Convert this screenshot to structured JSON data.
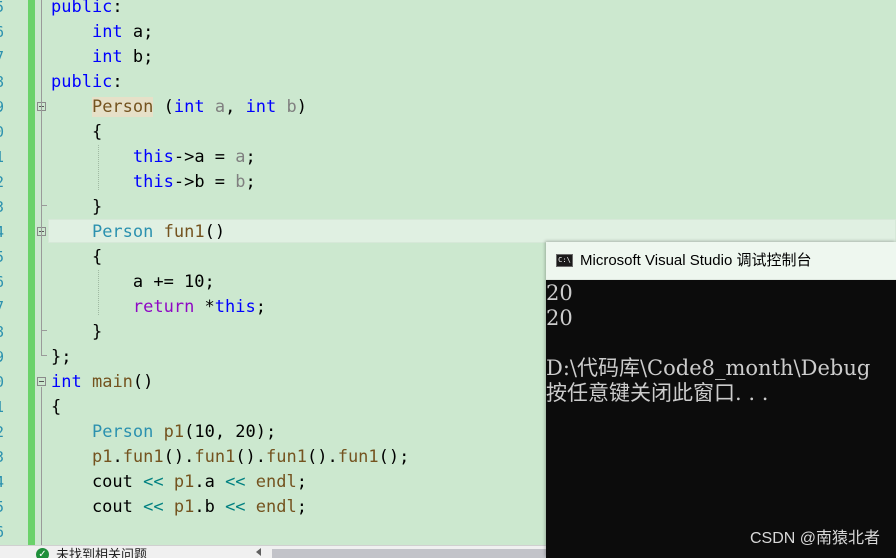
{
  "editor": {
    "line_numbers": [
      "5",
      "6",
      "7",
      "8",
      "9",
      "0",
      "1",
      "2",
      "3",
      "4",
      "5",
      "6",
      "7",
      "8",
      "9",
      "0",
      "1",
      "2",
      "3",
      "4",
      "5",
      "6"
    ],
    "lines": [
      {
        "segments": [
          {
            "t": "public",
            "c": "kw"
          },
          {
            "t": ":",
            "c": ""
          }
        ]
      },
      {
        "segments": [
          {
            "t": "    ",
            "c": ""
          },
          {
            "t": "int",
            "c": "kw"
          },
          {
            "t": " a;",
            "c": ""
          }
        ]
      },
      {
        "segments": [
          {
            "t": "    ",
            "c": ""
          },
          {
            "t": "int",
            "c": "kw"
          },
          {
            "t": " b;",
            "c": ""
          }
        ]
      },
      {
        "segments": [
          {
            "t": "public",
            "c": "kw"
          },
          {
            "t": ":",
            "c": ""
          }
        ]
      },
      {
        "segments": [
          {
            "t": "    ",
            "c": ""
          },
          {
            "t": "Person",
            "c": "fn hl"
          },
          {
            "t": " (",
            "c": ""
          },
          {
            "t": "int",
            "c": "kw"
          },
          {
            "t": " ",
            "c": ""
          },
          {
            "t": "a",
            "c": "pm"
          },
          {
            "t": ", ",
            "c": ""
          },
          {
            "t": "int",
            "c": "kw"
          },
          {
            "t": " ",
            "c": ""
          },
          {
            "t": "b",
            "c": "pm"
          },
          {
            "t": ")",
            "c": ""
          }
        ]
      },
      {
        "segments": [
          {
            "t": "    {",
            "c": ""
          }
        ]
      },
      {
        "segments": [
          {
            "t": "        ",
            "c": ""
          },
          {
            "t": "this",
            "c": "kw"
          },
          {
            "t": "->a = ",
            "c": ""
          },
          {
            "t": "a",
            "c": "pm"
          },
          {
            "t": ";",
            "c": ""
          }
        ]
      },
      {
        "segments": [
          {
            "t": "        ",
            "c": ""
          },
          {
            "t": "this",
            "c": "kw"
          },
          {
            "t": "->b = ",
            "c": ""
          },
          {
            "t": "b",
            "c": "pm"
          },
          {
            "t": ";",
            "c": ""
          }
        ]
      },
      {
        "segments": [
          {
            "t": "    }",
            "c": ""
          }
        ]
      },
      {
        "segments": [
          {
            "t": "    ",
            "c": ""
          },
          {
            "t": "Person",
            "c": "ty"
          },
          {
            "t": " ",
            "c": ""
          },
          {
            "t": "fun1",
            "c": "fn"
          },
          {
            "t": "()",
            "c": ""
          }
        ]
      },
      {
        "segments": [
          {
            "t": "    {",
            "c": ""
          }
        ]
      },
      {
        "segments": [
          {
            "t": "        a += 10;",
            "c": ""
          }
        ]
      },
      {
        "segments": [
          {
            "t": "        ",
            "c": ""
          },
          {
            "t": "return",
            "c": "ctl"
          },
          {
            "t": " *",
            "c": ""
          },
          {
            "t": "this",
            "c": "kw"
          },
          {
            "t": ";",
            "c": ""
          }
        ]
      },
      {
        "segments": [
          {
            "t": "    }",
            "c": ""
          }
        ]
      },
      {
        "segments": [
          {
            "t": "};",
            "c": ""
          }
        ]
      },
      {
        "segments": [
          {
            "t": "int",
            "c": "kw"
          },
          {
            "t": " ",
            "c": ""
          },
          {
            "t": "main",
            "c": "fn"
          },
          {
            "t": "()",
            "c": ""
          }
        ]
      },
      {
        "segments": [
          {
            "t": "{",
            "c": ""
          }
        ]
      },
      {
        "segments": [
          {
            "t": "    ",
            "c": ""
          },
          {
            "t": "Person",
            "c": "ty"
          },
          {
            "t": " ",
            "c": ""
          },
          {
            "t": "p1",
            "c": "fn"
          },
          {
            "t": "(10, 20);",
            "c": ""
          }
        ]
      },
      {
        "segments": [
          {
            "t": "    ",
            "c": ""
          },
          {
            "t": "p1",
            "c": "fn"
          },
          {
            "t": ".",
            "c": ""
          },
          {
            "t": "fun1",
            "c": "fn"
          },
          {
            "t": "().",
            "c": ""
          },
          {
            "t": "fun1",
            "c": "fn"
          },
          {
            "t": "().",
            "c": ""
          },
          {
            "t": "fun1",
            "c": "fn"
          },
          {
            "t": "().",
            "c": ""
          },
          {
            "t": "fun1",
            "c": "fn"
          },
          {
            "t": "();",
            "c": ""
          }
        ]
      },
      {
        "segments": [
          {
            "t": "    cout ",
            "c": ""
          },
          {
            "t": "<<",
            "c": "op"
          },
          {
            "t": " ",
            "c": ""
          },
          {
            "t": "p1",
            "c": "fn"
          },
          {
            "t": ".a ",
            "c": ""
          },
          {
            "t": "<<",
            "c": "op"
          },
          {
            "t": " ",
            "c": ""
          },
          {
            "t": "endl",
            "c": "fn"
          },
          {
            "t": ";",
            "c": ""
          }
        ]
      },
      {
        "segments": [
          {
            "t": "    cout ",
            "c": ""
          },
          {
            "t": "<<",
            "c": "op"
          },
          {
            "t": " ",
            "c": ""
          },
          {
            "t": "p1",
            "c": "fn"
          },
          {
            "t": ".b ",
            "c": ""
          },
          {
            "t": "<<",
            "c": "op"
          },
          {
            "t": " ",
            "c": ""
          },
          {
            "t": "endl",
            "c": "fn"
          },
          {
            "t": ";",
            "c": ""
          }
        ]
      }
    ],
    "colors": {
      "background": "#cce8cf",
      "keyword": "#0000ff",
      "type": "#2b91af",
      "parameter": "#808080",
      "control": "#8f08c4",
      "function": "#74531f",
      "operator": "#008080"
    }
  },
  "statusbar": {
    "icon": "check-circle-icon",
    "message": "未找到相关问题"
  },
  "console": {
    "icon": "console-app-icon",
    "icon_text": "C:\\",
    "title": "Microsoft Visual Studio 调试控制台",
    "output_lines": [
      "20",
      "20",
      "",
      "D:\\代码库\\Code8_month\\Debug",
      "按任意键关闭此窗口. . ."
    ]
  },
  "watermark": "CSDN @南猿北者"
}
